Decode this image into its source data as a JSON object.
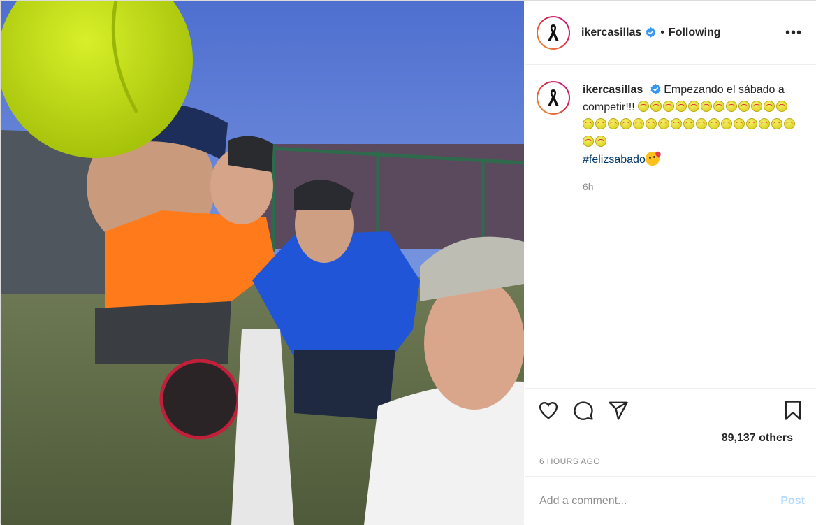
{
  "header": {
    "username": "ikercasillas",
    "separator": "•",
    "follow_status": "Following",
    "more_label": "•••"
  },
  "caption": {
    "username": "ikercasillas",
    "text": "Empezando el sábado a competir!!!",
    "emoji_count": 31,
    "emoji_name": "softball-emoji",
    "hashtag": "#felizsabado",
    "trailing_emoji": "kissing-face-emoji",
    "time_ago": "6h"
  },
  "actions": {
    "like_icon": "heart-icon",
    "comment_icon": "comment-icon",
    "share_icon": "paper-plane-icon",
    "save_icon": "bookmark-icon",
    "likes_text": "89,137 others",
    "posted_time": "6 HOURS AGO"
  },
  "comment": {
    "placeholder": "Add a comment...",
    "post_label": "Post"
  },
  "colors": {
    "verified": "#3897f0",
    "hashtag": "#00376b",
    "post_disabled": "#b3dbff",
    "muted": "#8e8e8e"
  }
}
